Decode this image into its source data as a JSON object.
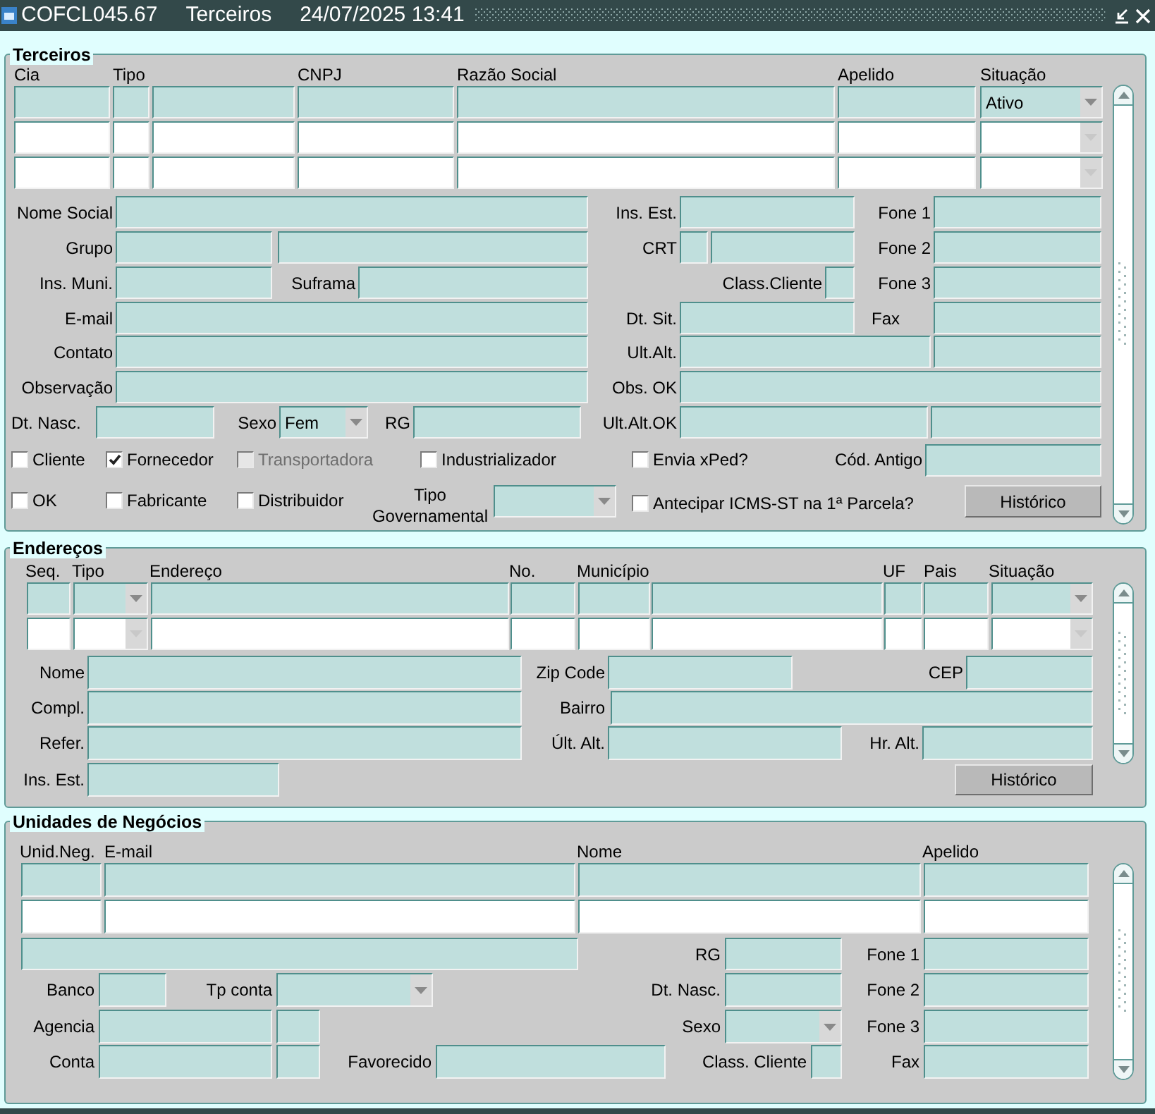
{
  "window": {
    "title": "COFCL045.67",
    "module": "Terceiros",
    "datetime": "24/07/2025 13:41"
  },
  "terceiros": {
    "title": "Terceiros",
    "columns": [
      "Cia",
      "Tipo",
      "CNPJ",
      "Razão Social",
      "Apelido",
      "Situação"
    ],
    "rows": [
      {
        "selected": true,
        "situacao": "Ativo"
      },
      {
        "selected": false
      },
      {
        "selected": false
      }
    ],
    "labels": [
      "Nome Social",
      "Ins. Est.",
      "Fone 1",
      "Grupo",
      "CRT",
      "Fone 2",
      "Ins. Muni.",
      "Suframa",
      "Class.Cliente",
      "Fone 3",
      "E-mail",
      "Dt. Sit.",
      "Fax",
      "Contato",
      "Ult.Alt.",
      "Observação",
      "Obs. OK",
      "Dt. Nasc.",
      "Sexo",
      "RG",
      "Ult.Alt.OK",
      "Cód. Antigo",
      "Tipo Governamental"
    ],
    "sexo": "Fem",
    "checkboxes": [
      {
        "label": "Cliente",
        "checked": false,
        "disabled": false
      },
      {
        "label": "Fornecedor",
        "checked": true,
        "disabled": false
      },
      {
        "label": "Transportadora",
        "checked": false,
        "disabled": true
      },
      {
        "label": "Industrializador",
        "checked": false,
        "disabled": false
      },
      {
        "label": "Envia xPed?",
        "checked": false,
        "disabled": false
      },
      {
        "label": "OK",
        "checked": false,
        "disabled": false
      },
      {
        "label": "Fabricante",
        "checked": false,
        "disabled": false
      },
      {
        "label": "Distribuidor",
        "checked": false,
        "disabled": false
      },
      {
        "label": "Antecipar ICMS-ST na 1ª Parcela?",
        "checked": false,
        "disabled": false
      }
    ],
    "history_button": "Histórico"
  },
  "enderecos": {
    "title": "Endereços",
    "columns": [
      "Seq.",
      "Tipo",
      "Endereço",
      "No.",
      "Município",
      "UF",
      "Pais",
      "Situação"
    ],
    "rows": [
      {
        "selected": true
      },
      {
        "selected": false
      }
    ],
    "labels": [
      "Nome",
      "Zip Code",
      "CEP",
      "Compl.",
      "Bairro",
      "Refer.",
      "Últ. Alt.",
      "Hr. Alt.",
      "Ins. Est."
    ],
    "history_button": "Histórico"
  },
  "unidades": {
    "title": "Unidades de Negócios",
    "columns": [
      "Unid.Neg.",
      "E-mail",
      "Nome",
      "Apelido"
    ],
    "rows": [
      {
        "selected": true
      },
      {
        "selected": false
      }
    ],
    "labels": [
      "RG",
      "Fone 1",
      "Banco",
      "Tp conta",
      "Dt. Nasc.",
      "Fone 2",
      "Agencia",
      "Sexo",
      "Fone 3",
      "Conta",
      "Favorecido",
      "Class. Cliente",
      "Fax"
    ]
  }
}
